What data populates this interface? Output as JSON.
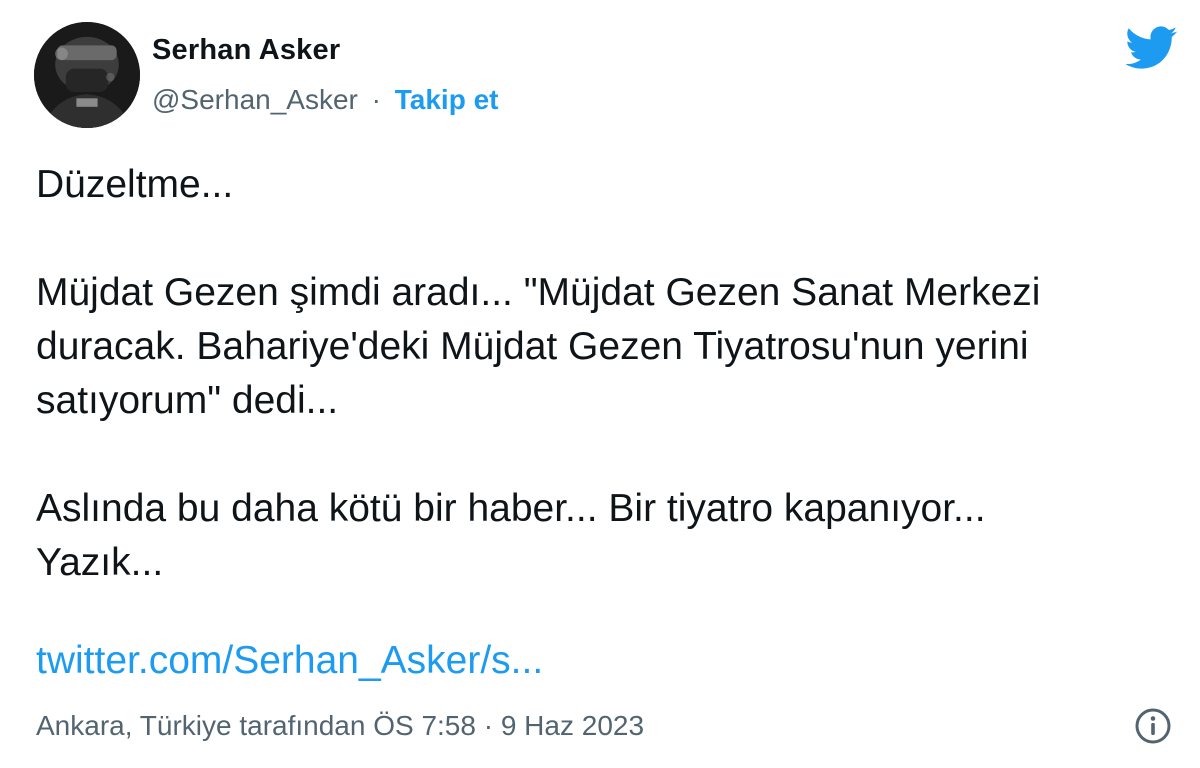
{
  "author": {
    "name": "Serhan Asker",
    "handle": "@Serhan_Asker",
    "separator": "·",
    "follow_label": "Takip et"
  },
  "tweet": {
    "paragraphs": [
      [
        "Düzeltme..."
      ],
      [
        "Müjdat Gezen şimdi aradı... \"Müjdat Gezen Sanat Merkezi",
        "duracak. Bahariye'deki Müjdat Gezen Tiyatrosu'nun yerini",
        "satıyorum\" dedi..."
      ],
      [
        "Aslında bu daha kötü bir haber... Bir tiyatro kapanıyor...",
        "Yazık..."
      ]
    ],
    "link": "twitter.com/Serhan_Asker/s...",
    "meta": "Ankara, Türkiye tarafından ÖS 7:58 · 9 Haz 2023"
  },
  "icons": {
    "brand": "twitter-bird-icon",
    "info": "info-icon",
    "avatar": "profile-photo"
  },
  "colors": {
    "accent": "#1d9bf0",
    "text": "#0f1419",
    "secondary": "#536471"
  }
}
